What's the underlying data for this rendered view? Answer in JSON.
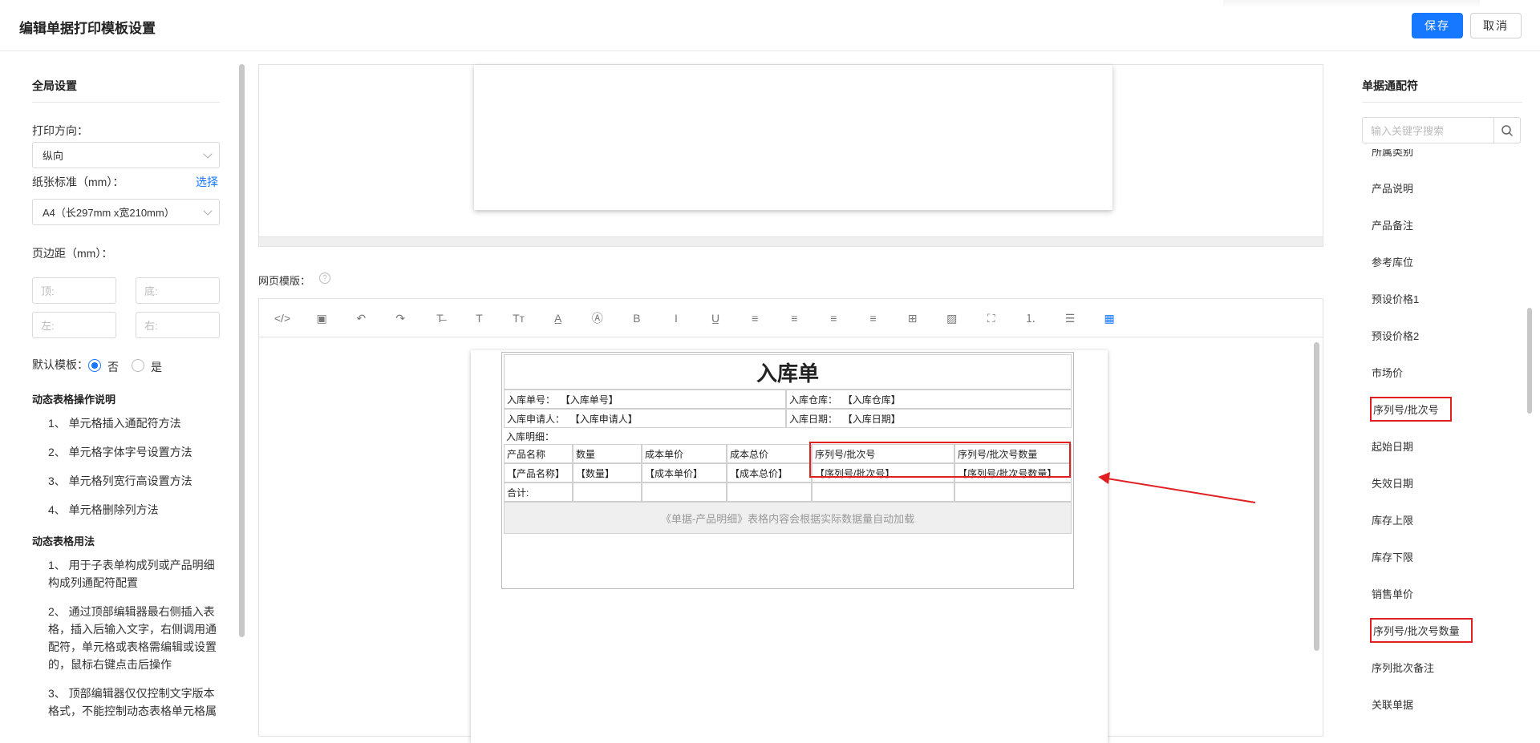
{
  "header": {
    "title": "编辑单据打印模板设置",
    "save_label": "保存",
    "cancel_label": "取消"
  },
  "left": {
    "section_title": "全局设置",
    "orientation_label": "打印方向：",
    "orientation_value": "纵向",
    "paper_label": "纸张标准（mm）：",
    "paper_select_link": "选择",
    "paper_value": "A4（长297mm x宽210mm）",
    "margin_label": "页边距（mm）：",
    "margin_top_placeholder": "顶:",
    "margin_bottom_placeholder": "底:",
    "margin_left_placeholder": "左:",
    "margin_right_placeholder": "右:",
    "default_template_label": "默认模板：",
    "default_no": "否",
    "default_yes": "是",
    "ops_title": "动态表格操作说明",
    "ops": [
      "1、 单元格插入通配符方法",
      "2、 单元格字体字号设置方法",
      "3、 单元格列宽行高设置方法",
      "4、 单元格删除列方法"
    ],
    "usage_title": "动态表格用法",
    "usage": [
      "1、 用于子表单构成列或产品明细构成列通配符配置",
      "2、 通过顶部编辑器最右侧插入表格，插入后输入文字，右侧调用通配符，单元格或表格需编辑或设置的，鼠标右键点击后操作",
      "3、 顶部编辑器仅仅控制文字版本格式，不能控制动态表格单元格属"
    ]
  },
  "center": {
    "web_template_label": "网页模版：",
    "help_icon": "?",
    "toolbar_icons": [
      "code-icon",
      "template-icon",
      "undo-icon",
      "redo-icon",
      "strikethrough-icon",
      "text-icon",
      "font-size-icon",
      "font-color-icon",
      "background-color-icon",
      "bold-icon",
      "italic-icon",
      "underline-icon",
      "align-left-icon",
      "align-center-icon",
      "align-right-icon",
      "justify-icon",
      "table-icon",
      "image-icon",
      "fullscreen-icon",
      "ordered-list-icon",
      "unordered-list-icon",
      "insert-table-icon"
    ],
    "toolbar_glyphs": [
      "</>",
      "▣",
      "↶",
      "↷",
      "T̶",
      "T",
      "Tт",
      "A̲",
      "Ⓐ",
      "B",
      "I",
      "U̲",
      "≡",
      "≡",
      "≡",
      "≡",
      "⊞",
      "▨",
      "⛶",
      "⒈",
      "☰",
      "▦"
    ],
    "doc": {
      "title": "入库单",
      "receipt_no_label": "入库单号：",
      "receipt_no_value": "【入库单号】",
      "warehouse_label": "入库仓库：",
      "warehouse_value": "【入库仓库】",
      "applicant_label": "入库申请人：",
      "applicant_value": "【入库申请人】",
      "date_label": "入库日期：",
      "date_value": "【入库日期】",
      "detail_label": "入库明细：",
      "columns": [
        "产品名称",
        "数量",
        "成本单价",
        "成本总价",
        "序列号/批次号",
        "序列号/批次号数量"
      ],
      "row": [
        "【产品名称】",
        "【数量】",
        "【成本单价】",
        "【成本总价】",
        "【序列号/批次号】",
        "【序列号/批次号数量】"
      ],
      "total_label": "合计:",
      "notice": "《单据-产品明细》表格内容会根据实际数据量自动加载"
    }
  },
  "right": {
    "section_title": "单据通配符",
    "search_placeholder": "输入关键字搜索",
    "items": [
      "所属类别",
      "产品说明",
      "产品备注",
      "参考库位",
      "预设价格1",
      "预设价格2",
      "市场价",
      "序列号/批次号",
      "起始日期",
      "失效日期",
      "库存上限",
      "库存下限",
      "销售单价",
      "序列号/批次号数量",
      "序列批次备注",
      "关联单据"
    ]
  },
  "colors": {
    "accent": "#1677ff",
    "highlight": "#e02020"
  }
}
